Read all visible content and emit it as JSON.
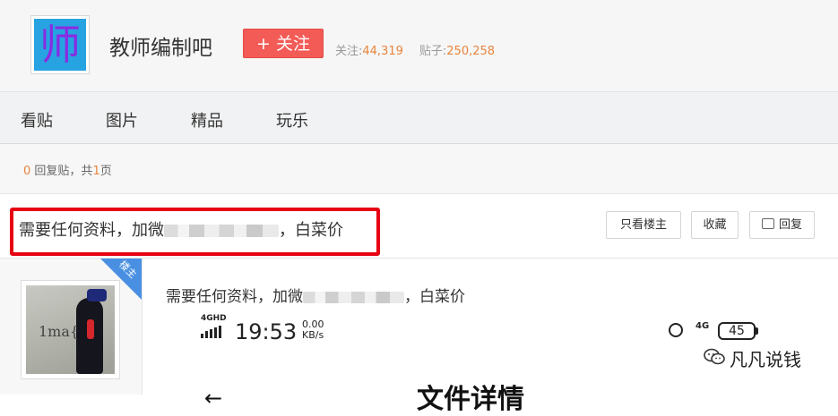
{
  "forum": {
    "name": "教师编制吧",
    "logo_char": "师",
    "follow_label": "+ 关注",
    "stats": {
      "followers_label": "关注:",
      "followers": "44,319",
      "posts_label": "贴子:",
      "posts": "250,258"
    }
  },
  "tabs": [
    "看贴",
    "图片",
    "精品",
    "玩乐"
  ],
  "thread_meta": {
    "reply_count": "0",
    "reply_label": "回复贴，共",
    "page_count": "1",
    "page_suffix": "页"
  },
  "thread": {
    "title_prefix": "需要任何资料，加微",
    "title_suffix": "，白菜价",
    "buttons": {
      "only_op": "只看楼主",
      "favorite": "收藏",
      "reply": "回复"
    }
  },
  "post": {
    "op_badge": "楼主",
    "content_prefix": "需要任何资料，加微",
    "content_suffix": "，白菜价",
    "avatar_scrawl": "1ma{",
    "screenshot": {
      "network_label": "4GHD",
      "time": "19:53",
      "speed_value": "0.00",
      "speed_unit": "KB/s",
      "net_label_right": "4G",
      "battery": "45",
      "doc_title": "文件详情",
      "back_arrow": "←"
    }
  },
  "watermark": "凡凡说钱",
  "colors": {
    "follow_button": "#f35b56",
    "stat_number": "#e8843c",
    "highlight_border": "#e60012",
    "op_badge": "#4a90e2",
    "logo_bg": "#27a3e2"
  }
}
